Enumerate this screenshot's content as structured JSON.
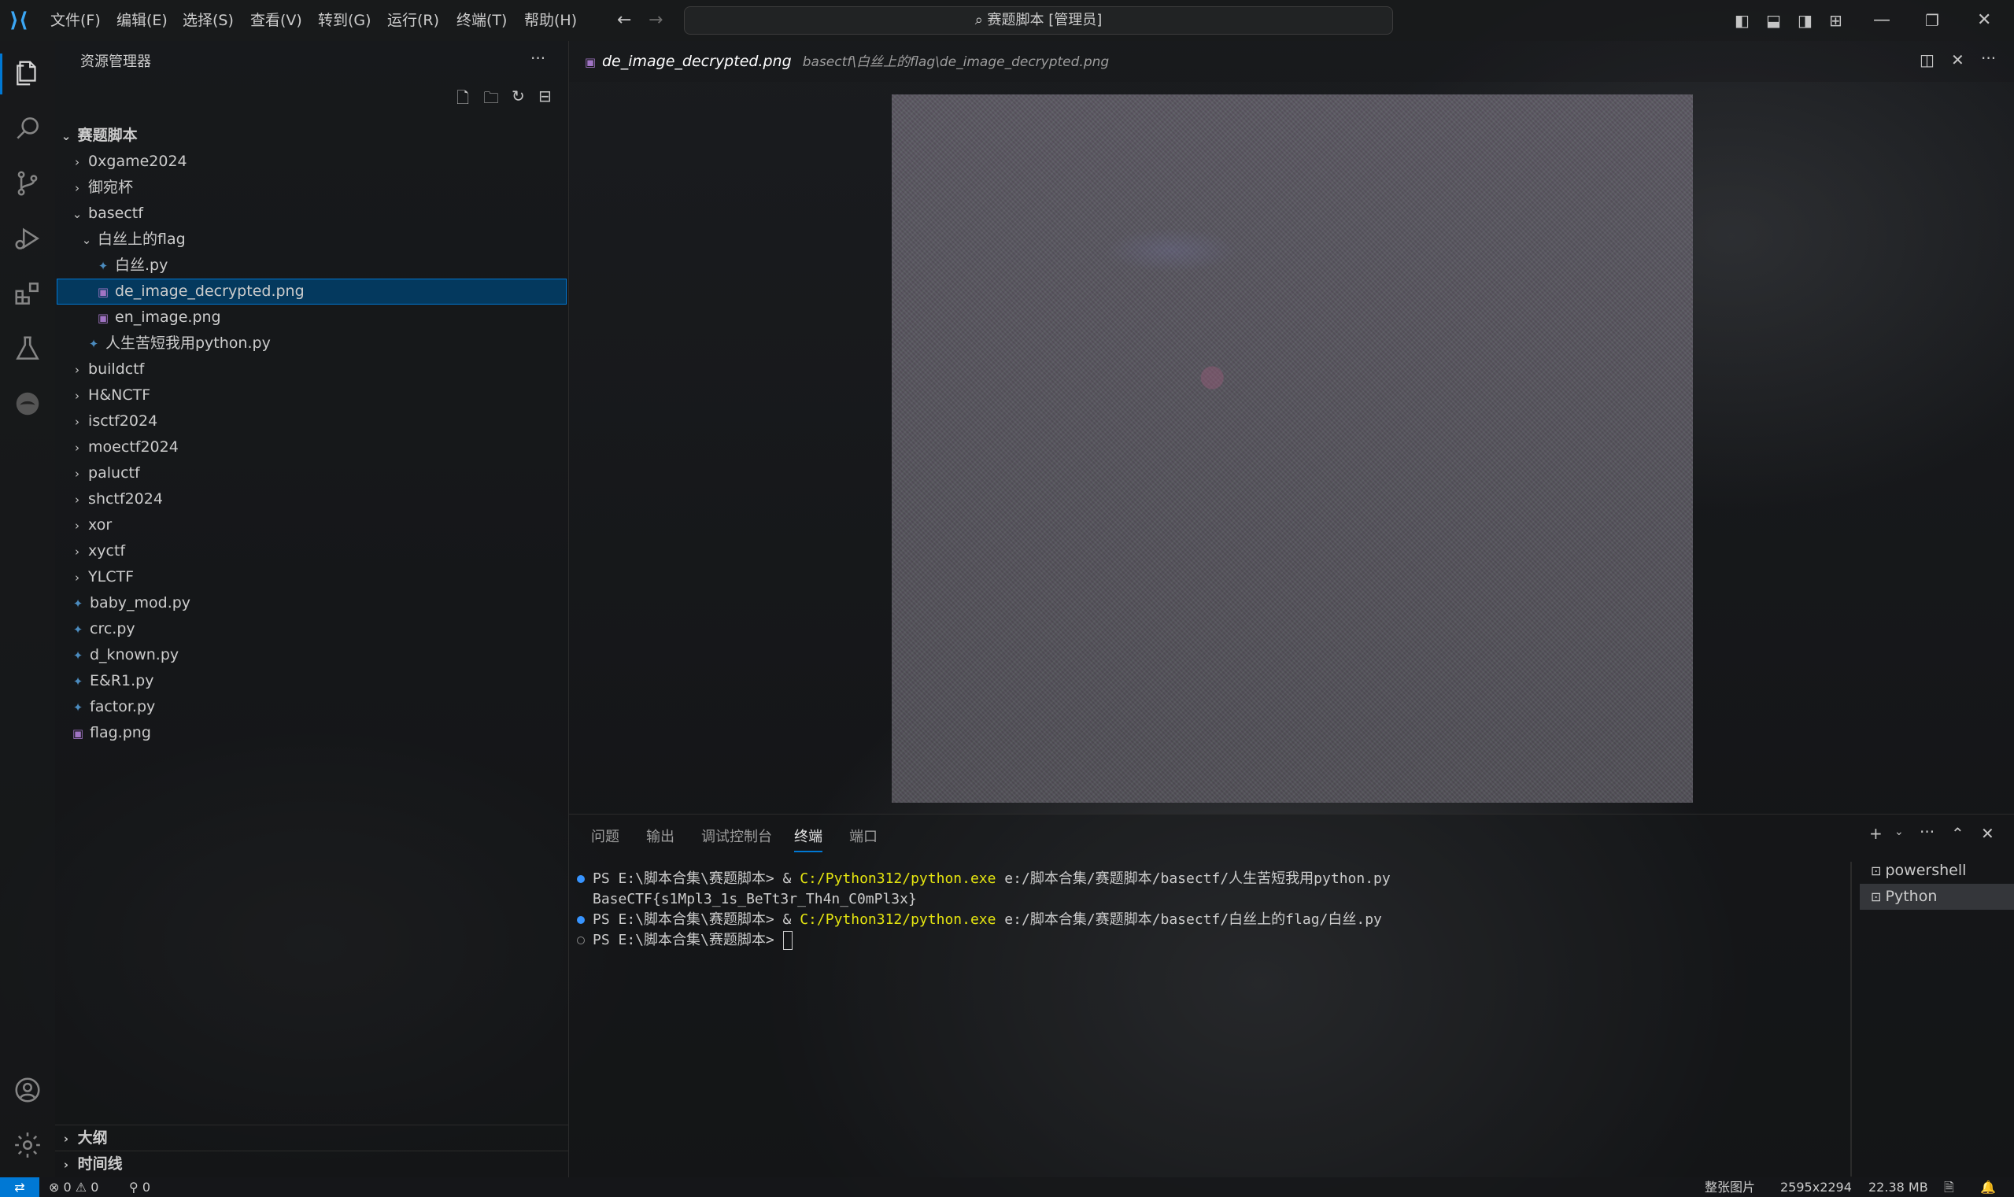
{
  "titlebar": {
    "menu": [
      "文件(F)",
      "编辑(E)",
      "选择(S)",
      "查看(V)",
      "转到(G)",
      "运行(R)",
      "终端(T)",
      "帮助(H)"
    ],
    "command_center": "赛题脚本 [管理员]"
  },
  "sidebar": {
    "title": "资源管理器",
    "root": "赛题脚本",
    "tree": [
      {
        "label": "0xgame2024"
      },
      {
        "label": "御宛杯"
      },
      {
        "label": "basectf"
      },
      {
        "label": "白丝上的flag"
      },
      {
        "label": "白丝.py"
      },
      {
        "label": "de_image_decrypted.png"
      },
      {
        "label": "en_image.png"
      },
      {
        "label": "人生苦短我用python.py"
      },
      {
        "label": "buildctf"
      },
      {
        "label": "H&NCTF"
      },
      {
        "label": "isctf2024"
      },
      {
        "label": "moectf2024"
      },
      {
        "label": "paluctf"
      },
      {
        "label": "shctf2024"
      },
      {
        "label": "xor"
      },
      {
        "label": "xyctf"
      },
      {
        "label": "YLCTF"
      },
      {
        "label": "baby_mod.py"
      },
      {
        "label": "crc.py"
      },
      {
        "label": "d_known.py"
      },
      {
        "label": "E&R1.py"
      },
      {
        "label": "factor.py"
      },
      {
        "label": "flag.png"
      }
    ],
    "outline": "大纲",
    "timeline": "时间线"
  },
  "editor": {
    "tab_name": "de_image_decrypted.png",
    "tab_path": "basectf\\白丝上的flag\\de_image_decrypted.png"
  },
  "panel": {
    "tabs": [
      "问题",
      "输出",
      "调试控制台",
      "终端",
      "端口"
    ],
    "terminal": {
      "line1_prompt": "PS E:\\脚本合集\\赛题脚本> & ",
      "line1_exe": "C:/Python312/python.exe",
      "line1_arg": " e:/脚本合集/赛题脚本/basectf/人生苦短我用python.py",
      "line2": "BaseCTF{s1Mpl3_1s_BeTt3r_Th4n_C0mPl3x}",
      "line3_prompt": "PS E:\\脚本合集\\赛题脚本> & ",
      "line3_exe": "C:/Python312/python.exe",
      "line3_arg": " e:/脚本合集/赛题脚本/basectf/白丝上的flag/白丝.py",
      "line4_prompt": "PS E:\\脚本合集\\赛题脚本> "
    },
    "terminals": [
      "powershell",
      "Python"
    ]
  },
  "statusbar": {
    "errors": "0",
    "warnings": "0",
    "ports": "0",
    "zoom_mode": "整张图片",
    "dimensions": "2595x2294",
    "filesize": "22.38 MB"
  },
  "colors": {
    "accent": "#0078d4",
    "selection": "#04395e",
    "terminal_exe": "#e5e510",
    "python_icon": "#4b8bbe",
    "image_icon": "#a074c4"
  }
}
